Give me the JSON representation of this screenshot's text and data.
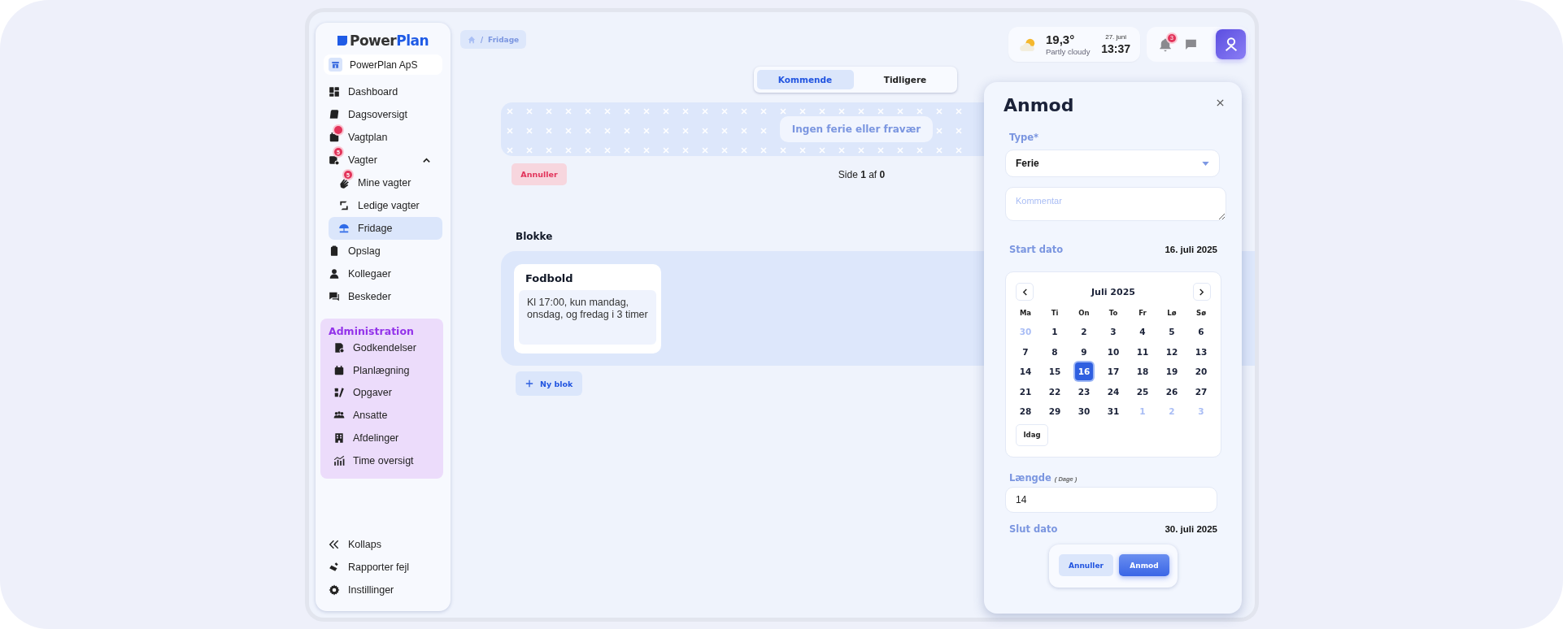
{
  "sidebar": {
    "logo": {
      "part_1": "Power",
      "part_2": "Plan"
    },
    "company": "PowerPlan ApS",
    "items": [
      {
        "label": "Dashboard",
        "selected": false,
        "dot": false
      },
      {
        "label": "Dagsoversigt",
        "selected": false,
        "dot": false
      },
      {
        "label": "Vagtplan",
        "selected": false,
        "dot": true
      },
      {
        "label": "Vagter",
        "selected": false,
        "dot": false,
        "badge": "5",
        "expanded": true,
        "children": [
          {
            "label": "Mine vagter",
            "selected": false,
            "badge": "5"
          },
          {
            "label": "Ledige vagter",
            "selected": false
          },
          {
            "label": "Fridage",
            "selected": true
          }
        ]
      },
      {
        "label": "Opslag",
        "selected": false,
        "dot": false
      },
      {
        "label": "Kollegaer",
        "selected": false,
        "dot": false
      },
      {
        "label": "Beskeder",
        "selected": false,
        "dot": false
      }
    ],
    "admin": {
      "title": "Administration",
      "items": [
        {
          "label": "Godkendelser",
          "selected": false
        },
        {
          "label": "Planlægning",
          "selected": false
        },
        {
          "label": "Opgaver",
          "selected": false
        },
        {
          "label": "Ansatte",
          "selected": false
        },
        {
          "label": "Afdelinger",
          "selected": false
        },
        {
          "label": "Time oversigt",
          "selected": false
        }
      ]
    },
    "footer": [
      {
        "label": "Kollaps"
      },
      {
        "label": "Rapporter fejl"
      },
      {
        "label": "Instillinger"
      }
    ]
  },
  "breadcrumb": {
    "separator": "/",
    "current": "Fridage"
  },
  "header": {
    "weather": {
      "temperature": "19,3°",
      "condition": "Partly cloudy"
    },
    "clock": {
      "date": "27. juni",
      "time": "13:37"
    },
    "notifications": "3"
  },
  "tabs": [
    {
      "label": "Kommende",
      "selected": true
    },
    {
      "label": "Tidligere",
      "selected": false
    }
  ],
  "empty_message": "Ingen ferie eller fravær",
  "cancel_button": "Annuller",
  "pagination": "Side **1** af **0**",
  "blocks": {
    "title": "Blokke",
    "items": [
      {
        "title": "Fodbold",
        "description": "Kl 17:00, kun mandag, onsdag, og fredag i 3 timer"
      }
    ],
    "new_button": "Ny blok"
  },
  "panel": {
    "title": "Anmod",
    "type_label": "Type*",
    "type_value": "Ferie",
    "comment_placeholder": "Kommentar",
    "start_label": "Start dato",
    "start_value": "16. juli 2025",
    "calendar": {
      "month": "Juli 2025",
      "weekdays": [
        "Ma",
        "Ti",
        "On",
        "To",
        "Fr",
        "Lø",
        "Sø"
      ],
      "days": [
        {
          "label": "30",
          "outside": true,
          "selected": false
        },
        {
          "label": "1",
          "outside": false,
          "selected": false
        },
        {
          "label": "2",
          "outside": false,
          "selected": false
        },
        {
          "label": "3",
          "outside": false,
          "selected": false
        },
        {
          "label": "4",
          "outside": false,
          "selected": false
        },
        {
          "label": "5",
          "outside": false,
          "selected": false
        },
        {
          "label": "6",
          "outside": false,
          "selected": false
        },
        {
          "label": "7",
          "outside": false,
          "selected": false
        },
        {
          "label": "8",
          "outside": false,
          "selected": false
        },
        {
          "label": "9",
          "outside": false,
          "selected": false
        },
        {
          "label": "10",
          "outside": false,
          "selected": false
        },
        {
          "label": "11",
          "outside": false,
          "selected": false
        },
        {
          "label": "12",
          "outside": false,
          "selected": false
        },
        {
          "label": "13",
          "outside": false,
          "selected": false
        },
        {
          "label": "14",
          "outside": false,
          "selected": false
        },
        {
          "label": "15",
          "outside": false,
          "selected": false
        },
        {
          "label": "16",
          "outside": false,
          "selected": true
        },
        {
          "label": "17",
          "outside": false,
          "selected": false
        },
        {
          "label": "18",
          "outside": false,
          "selected": false
        },
        {
          "label": "19",
          "outside": false,
          "selected": false
        },
        {
          "label": "20",
          "outside": false,
          "selected": false
        },
        {
          "label": "21",
          "outside": false,
          "selected": false
        },
        {
          "label": "22",
          "outside": false,
          "selected": false
        },
        {
          "label": "23",
          "outside": false,
          "selected": false
        },
        {
          "label": "24",
          "outside": false,
          "selected": false
        },
        {
          "label": "25",
          "outside": false,
          "selected": false
        },
        {
          "label": "26",
          "outside": false,
          "selected": false
        },
        {
          "label": "27",
          "outside": false,
          "selected": false
        },
        {
          "label": "28",
          "outside": false,
          "selected": false
        },
        {
          "label": "29",
          "outside": false,
          "selected": false
        },
        {
          "label": "30",
          "outside": false,
          "selected": false
        },
        {
          "label": "31",
          "outside": false,
          "selected": false
        },
        {
          "label": "1",
          "outside": true,
          "selected": false
        },
        {
          "label": "2",
          "outside": true,
          "selected": false
        },
        {
          "label": "3",
          "outside": true,
          "selected": false
        }
      ],
      "today_button": "Idag"
    },
    "length_label": "Længde",
    "length_unit": "( Dage )",
    "length_value": "14",
    "end_label": "Slut dato",
    "end_value": "30. juli 2025",
    "buttons": [
      {
        "label": "Annuller",
        "kind": "secondary"
      },
      {
        "label": "Anmod",
        "kind": "primary"
      }
    ]
  }
}
